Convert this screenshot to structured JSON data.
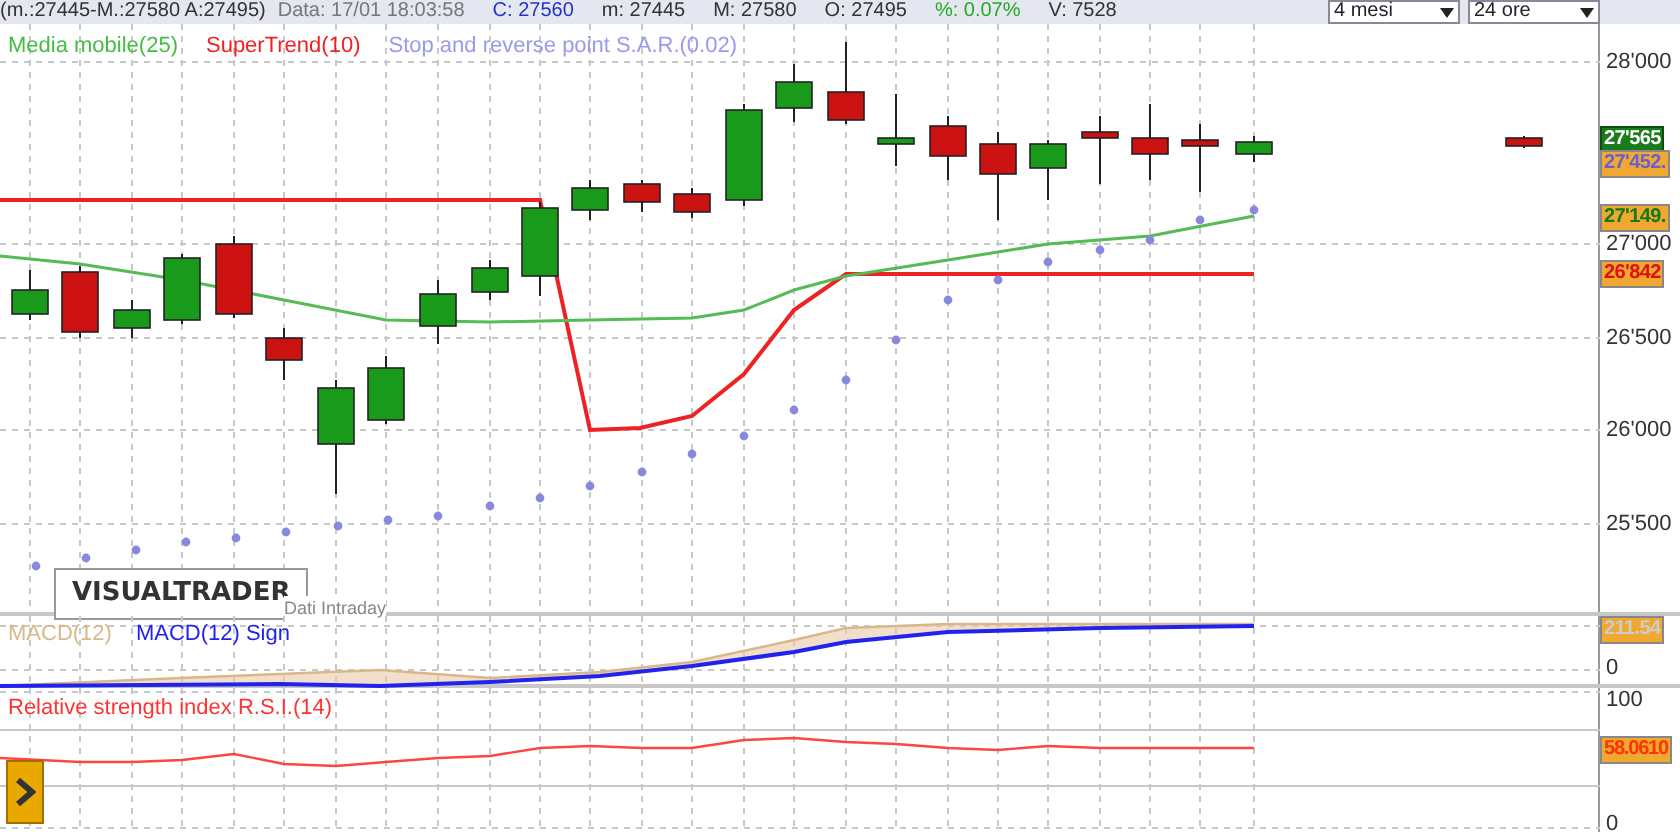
{
  "quote_bar": {
    "items": [
      {
        "text": "(m.:27445-M.:27580 A:27495)",
        "color": "#333333"
      },
      {
        "text": "Data: 17/01 18:03:58",
        "color": "#777777"
      },
      {
        "text": "C: 27560",
        "color": "#2233cc"
      },
      {
        "text": "m: 27445",
        "color": "#333333"
      },
      {
        "text": "M: 27580",
        "color": "#333333"
      },
      {
        "text": "O: 27495",
        "color": "#333333"
      },
      {
        "text": "%: 0.07%",
        "color": "#22aa22"
      },
      {
        "text": "V: 7528",
        "color": "#333333"
      }
    ],
    "selectors": [
      {
        "value": "4 mesi"
      },
      {
        "value": "24 ore"
      }
    ]
  },
  "price_chart": {
    "legend": [
      {
        "label": "Media mobile(25)",
        "color": "#44bb44"
      },
      {
        "label": "SuperTrend(10)",
        "color": "#ee2222"
      },
      {
        "label": "Stop and reverse point S.A.R.(0.02)",
        "color": "#9999ee"
      }
    ],
    "axis_labels": [
      "28'000",
      "27'000",
      "26'500",
      "26'000",
      "25'500"
    ],
    "price_tags": [
      {
        "text": "27'565",
        "kind": "last"
      },
      {
        "text": "27'452.",
        "kind": "sar"
      },
      {
        "text": "27'149.",
        "kind": "moving_average"
      },
      {
        "text": "26'842",
        "kind": "supertrend"
      }
    ],
    "logo": "VISUALTRADER",
    "source_note": "Dati Intraday"
  },
  "macd_panel": {
    "legend": [
      {
        "label": "MACD(12)",
        "color": "#d8b88a"
      },
      {
        "label": "MACD(12) Sign",
        "color": "#2222ee"
      }
    ],
    "axis_labels": [
      "0"
    ],
    "value_tag": "211.54"
  },
  "rsi_panel": {
    "title": "Relative strength index R.S.I.(14)",
    "axis_labels": [
      "100",
      "0"
    ],
    "value_tag": "58.0610"
  }
}
